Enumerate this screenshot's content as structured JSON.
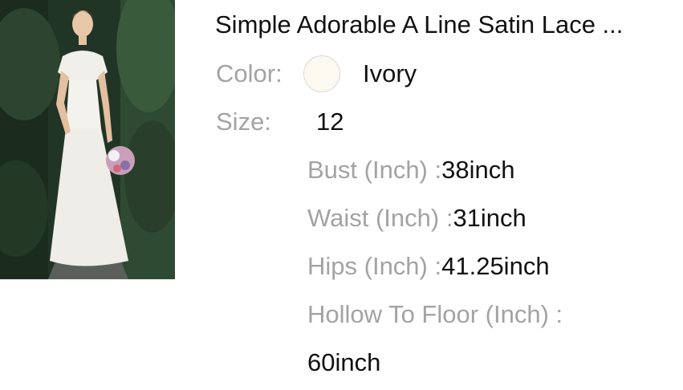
{
  "product": {
    "title": "Simple Adorable A Line Satin Lace ...",
    "image_alt": "wedding dress photo"
  },
  "color": {
    "label": "Color:",
    "value": "Ivory",
    "swatch_hex": "#fbf9f0"
  },
  "size": {
    "label": "Size:",
    "value": "12"
  },
  "measurements": [
    {
      "label": "Bust (Inch) :",
      "value": "38inch"
    },
    {
      "label": "Waist (Inch) :",
      "value": "31inch"
    },
    {
      "label": "Hips (Inch) :",
      "value": "41.25inch"
    },
    {
      "label": "Hollow To Floor (Inch) :",
      "value": "60inch"
    }
  ]
}
